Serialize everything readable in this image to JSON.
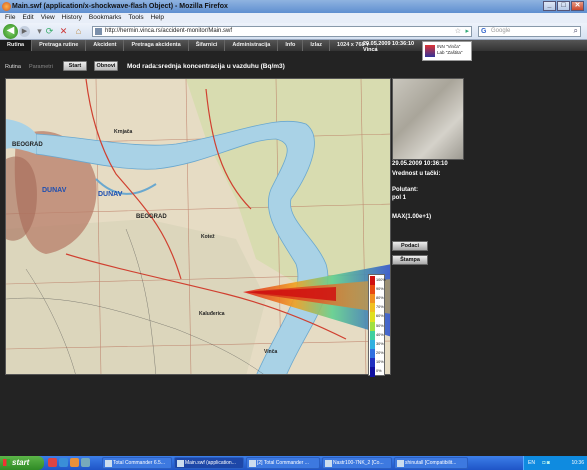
{
  "window": {
    "title": "Main.swf (application/x-shockwave-flash Object) - Mozilla Firefox",
    "controls": {
      "minimize": "_",
      "maximize": "□",
      "close": "✕"
    }
  },
  "menubar": [
    "File",
    "Edit",
    "View",
    "History",
    "Bookmarks",
    "Tools",
    "Help"
  ],
  "navbar": {
    "url": "http://hermin.vinca.rs/accident-monitor/Main.swf",
    "search_placeholder": "Google",
    "icons": [
      "back-icon",
      "forward-icon",
      "reload-icon",
      "stop-icon",
      "home-icon"
    ]
  },
  "app": {
    "menu": [
      "Rutina",
      "Pretraga rutine",
      "Akcident",
      "Pretraga akcidenta",
      "Šifarnici",
      "Administracija",
      "Info",
      "Izlaz",
      "1024 x 768"
    ],
    "active_menu": "Rutina",
    "datetime": "29.05.2009 10:36:10",
    "location": "Vinca",
    "logo_text": [
      "INN \"Vinča\"",
      "Lab \"Zaštita\""
    ],
    "tabs": [
      "Rutina",
      "Parametri"
    ],
    "buttons": {
      "start": "Start",
      "stop": "Obnovi"
    },
    "mode_text": "Mod rada:srednja koncentracija u vazduhu (Bq/m3)"
  },
  "map": {
    "labels": [
      "BEOGRAD",
      "DUNAV",
      "DUNAV",
      "BEOGRAD",
      "Krnjača",
      "Kotež",
      "Kaluđerica",
      "Vinča"
    ],
    "legend": [
      "100%",
      "90%",
      "80%",
      "70%",
      "60%",
      "50%",
      "40%",
      "30%",
      "20%",
      "10%",
      "0%"
    ],
    "legend_colors": [
      "#d01010",
      "#e84a10",
      "#f09020",
      "#f0c020",
      "#e0e020",
      "#a0e040",
      "#40d0a0",
      "#30b0e0",
      "#3070e0",
      "#2030c0",
      "#1010a0"
    ]
  },
  "panel": {
    "datetime": "29.05.2009 10:36:10",
    "value_label": "Vrednost u tački:",
    "pollutant_label": "Polutant:",
    "pollutant_value": "pol 1",
    "max_label": "MAX(1.00e+1)",
    "btn_results": "Podaci",
    "btn_print": "Štampa"
  },
  "taskbar": {
    "start": "start",
    "tasks": [
      "Total Commander 6.5...",
      "Main.swf (application...",
      "[2] Total Commander ...",
      "Nastr100-7NK_2 [Co...",
      "shinutall [Compatibilit..."
    ],
    "active_task": 1,
    "lang": "EN",
    "clock": "10:36"
  }
}
